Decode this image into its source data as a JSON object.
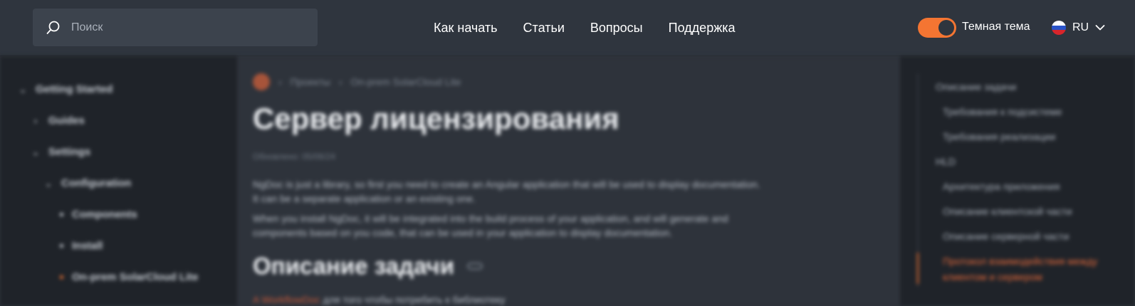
{
  "header": {
    "search": {
      "placeholder": "Поиск"
    },
    "nav": [
      "Как начать",
      "Статьи",
      "Вопросы",
      "Поддержка"
    ],
    "theme_toggle": {
      "label": "Темная тема",
      "on": true,
      "accent": "#f47532"
    },
    "language": {
      "code": "RU"
    }
  },
  "sidebar": {
    "items": [
      {
        "label": "Getting Started",
        "level": 0,
        "expanded": true
      },
      {
        "label": "Guides",
        "level": 1,
        "expanded": false
      },
      {
        "label": "Settings",
        "level": 1,
        "expanded": true
      },
      {
        "label": "Configuration",
        "level": 2,
        "expanded": true
      },
      {
        "label": "Components",
        "level": 3
      },
      {
        "label": "Install",
        "level": 3
      },
      {
        "label": "On-prem SolarCloud Lite",
        "level": 3,
        "active": true
      }
    ]
  },
  "main": {
    "breadcrumbs": [
      "Проекты",
      "On-prem SolarCloud Lite"
    ],
    "title": "Сервер лицензирования",
    "updated": "Обновлено: 05/06/24",
    "paragraphs": [
      "NgDoc is just a library, so first you need to create an Angular application that will be used to display documentation. It can be a separate application or an existing one.",
      "When you install NgDoc, it will be integrated into the build process of your application, and will generate and components based on you code, that can be used in your application to display documentation."
    ],
    "section_title": "Описание задачи",
    "section_text_link": "A WorkflowDoc",
    "section_text": "для того чтобы потребить к библиотеку"
  },
  "toc": {
    "items": [
      "Описание задачи",
      "Требования к подсистеме",
      "Требования реализации",
      "HLD",
      "Архитектура приложения",
      "Описание клиентской части",
      "Описание серверной части"
    ],
    "active": "Протокол взаимодействия между клиентом и сервером"
  }
}
